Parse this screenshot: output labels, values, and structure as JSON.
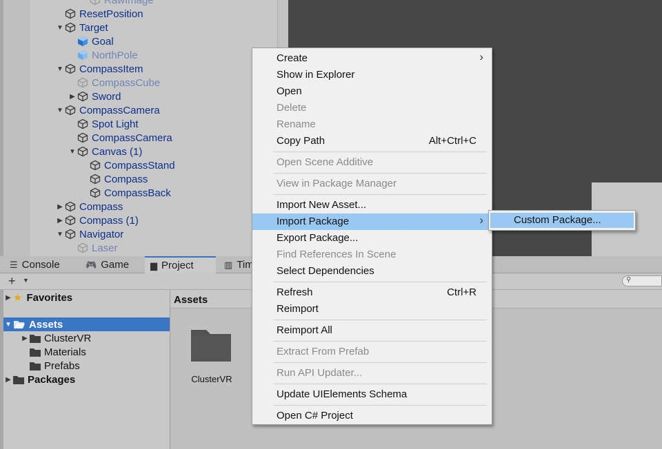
{
  "hierarchy": {
    "items": [
      {
        "label": "RawImage",
        "depth": 3,
        "arrow": "none",
        "dim": true,
        "icon": "gameobject-icon"
      },
      {
        "label": "ResetPosition",
        "depth": 1,
        "arrow": "none",
        "dim": false,
        "icon": "gameobject-icon"
      },
      {
        "label": "Target",
        "depth": 1,
        "arrow": "expanded",
        "dim": false,
        "icon": "gameobject-icon"
      },
      {
        "label": "Goal",
        "depth": 2,
        "arrow": "none",
        "dim": false,
        "icon": "prefab-icon"
      },
      {
        "label": "NorthPole",
        "depth": 2,
        "arrow": "none",
        "dim": true,
        "icon": "prefab-icon"
      },
      {
        "label": "CompassItem",
        "depth": 1,
        "arrow": "expanded",
        "dim": false,
        "icon": "gameobject-icon"
      },
      {
        "label": "CompassCube",
        "depth": 2,
        "arrow": "none",
        "dim": true,
        "icon": "gameobject-icon"
      },
      {
        "label": "Sword",
        "depth": 2,
        "arrow": "collapsed",
        "dim": false,
        "icon": "gameobject-icon"
      },
      {
        "label": "CompassCamera",
        "depth": 1,
        "arrow": "expanded",
        "dim": false,
        "icon": "gameobject-icon"
      },
      {
        "label": "Spot Light",
        "depth": 2,
        "arrow": "none",
        "dim": false,
        "icon": "gameobject-icon"
      },
      {
        "label": "CompassCamera",
        "depth": 2,
        "arrow": "none",
        "dim": false,
        "icon": "gameobject-icon"
      },
      {
        "label": "Canvas (1)",
        "depth": 2,
        "arrow": "expanded",
        "dim": false,
        "icon": "gameobject-icon"
      },
      {
        "label": "CompassStand",
        "depth": 3,
        "arrow": "none",
        "dim": false,
        "icon": "gameobject-icon"
      },
      {
        "label": "Compass",
        "depth": 3,
        "arrow": "none",
        "dim": false,
        "icon": "gameobject-icon"
      },
      {
        "label": "CompassBack",
        "depth": 3,
        "arrow": "none",
        "dim": false,
        "icon": "gameobject-icon"
      },
      {
        "label": "Compass",
        "depth": 1,
        "arrow": "collapsed",
        "dim": false,
        "icon": "gameobject-icon"
      },
      {
        "label": "Compass (1)",
        "depth": 1,
        "arrow": "collapsed",
        "dim": false,
        "icon": "gameobject-icon"
      },
      {
        "label": "Navigator",
        "depth": 1,
        "arrow": "expanded",
        "dim": false,
        "icon": "gameobject-icon"
      },
      {
        "label": "Laser",
        "depth": 2,
        "arrow": "none",
        "dim": true,
        "icon": "gameobject-icon"
      }
    ]
  },
  "tabs": [
    {
      "label": "Console",
      "icon": "console-icon",
      "active": false
    },
    {
      "label": "Game",
      "icon": "game-controller-icon",
      "active": false
    },
    {
      "label": "Project",
      "icon": "project-folder-icon",
      "active": true
    },
    {
      "label": "Tim",
      "icon": "timeline-icon",
      "active": false
    }
  ],
  "toolbar": {
    "add_icon": "plus-icon",
    "search_icon": "search-icon"
  },
  "project_tree": [
    {
      "label": "Favorites",
      "icon": "star-icon",
      "arrow": "collapsed",
      "bold": true,
      "depth": 0,
      "selected": false
    },
    {
      "label": "Assets",
      "icon": "folder-open-icon",
      "arrow": "expanded",
      "bold": true,
      "depth": 0,
      "selected": true
    },
    {
      "label": "ClusterVR",
      "icon": "folder-icon",
      "arrow": "collapsed",
      "bold": false,
      "depth": 1,
      "selected": false
    },
    {
      "label": "Materials",
      "icon": "folder-icon",
      "arrow": "none",
      "bold": false,
      "depth": 1,
      "selected": false
    },
    {
      "label": "Prefabs",
      "icon": "folder-icon",
      "arrow": "none",
      "bold": false,
      "depth": 1,
      "selected": false
    },
    {
      "label": "Packages",
      "icon": "folder-icon",
      "arrow": "collapsed",
      "bold": true,
      "depth": 0,
      "selected": false
    }
  ],
  "assets_panel": {
    "header": "Assets",
    "items": [
      {
        "label": "ClusterVR",
        "icon": "folder-icon"
      }
    ]
  },
  "context_menu": {
    "groups": [
      [
        {
          "label": "Create",
          "shortcut": "",
          "submenu": true,
          "disabled": false,
          "highlighted": false
        },
        {
          "label": "Show in Explorer",
          "shortcut": "",
          "submenu": false,
          "disabled": false,
          "highlighted": false
        },
        {
          "label": "Open",
          "shortcut": "",
          "submenu": false,
          "disabled": false,
          "highlighted": false
        },
        {
          "label": "Delete",
          "shortcut": "",
          "submenu": false,
          "disabled": true,
          "highlighted": false
        },
        {
          "label": "Rename",
          "shortcut": "",
          "submenu": false,
          "disabled": true,
          "highlighted": false
        },
        {
          "label": "Copy Path",
          "shortcut": "Alt+Ctrl+C",
          "submenu": false,
          "disabled": false,
          "highlighted": false
        }
      ],
      [
        {
          "label": "Open Scene Additive",
          "shortcut": "",
          "submenu": false,
          "disabled": true,
          "highlighted": false
        }
      ],
      [
        {
          "label": "View in Package Manager",
          "shortcut": "",
          "submenu": false,
          "disabled": true,
          "highlighted": false
        }
      ],
      [
        {
          "label": "Import New Asset...",
          "shortcut": "",
          "submenu": false,
          "disabled": false,
          "highlighted": false
        },
        {
          "label": "Import Package",
          "shortcut": "",
          "submenu": true,
          "disabled": false,
          "highlighted": true
        },
        {
          "label": "Export Package...",
          "shortcut": "",
          "submenu": false,
          "disabled": false,
          "highlighted": false
        },
        {
          "label": "Find References In Scene",
          "shortcut": "",
          "submenu": false,
          "disabled": true,
          "highlighted": false
        },
        {
          "label": "Select Dependencies",
          "shortcut": "",
          "submenu": false,
          "disabled": false,
          "highlighted": false
        }
      ],
      [
        {
          "label": "Refresh",
          "shortcut": "Ctrl+R",
          "submenu": false,
          "disabled": false,
          "highlighted": false
        },
        {
          "label": "Reimport",
          "shortcut": "",
          "submenu": false,
          "disabled": false,
          "highlighted": false
        }
      ],
      [
        {
          "label": "Reimport All",
          "shortcut": "",
          "submenu": false,
          "disabled": false,
          "highlighted": false
        }
      ],
      [
        {
          "label": "Extract From Prefab",
          "shortcut": "",
          "submenu": false,
          "disabled": true,
          "highlighted": false
        }
      ],
      [
        {
          "label": "Run API Updater...",
          "shortcut": "",
          "submenu": false,
          "disabled": true,
          "highlighted": false
        }
      ],
      [
        {
          "label": "Update UIElements Schema",
          "shortcut": "",
          "submenu": false,
          "disabled": false,
          "highlighted": false
        }
      ],
      [
        {
          "label": "Open C# Project",
          "shortcut": "",
          "submenu": false,
          "disabled": false,
          "highlighted": false
        }
      ]
    ]
  },
  "submenu": {
    "items": [
      {
        "label": "Custom Package...",
        "highlighted": true
      }
    ]
  },
  "colors": {
    "selection": "#3b76c4",
    "menu_highlight": "#99c9f3",
    "hierarchy_text": "#0b2f8a",
    "hierarchy_dim": "#6f86b4",
    "disabled_text": "#8a8a8a",
    "scene_bg": "#474747",
    "prefab_blue": "#3f8fe6"
  }
}
